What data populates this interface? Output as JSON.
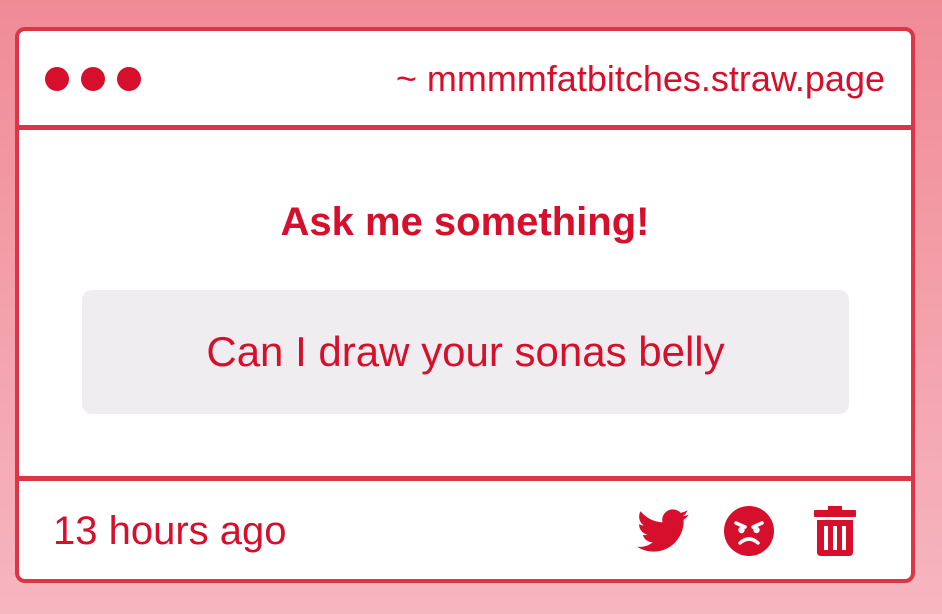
{
  "window": {
    "url": "~ mmmmfatbitches.straw.page"
  },
  "main": {
    "heading": "Ask me something!",
    "question": "Can I draw your sonas belly"
  },
  "footer": {
    "timestamp": "13 hours ago",
    "actions": [
      {
        "icon": "twitter-icon"
      },
      {
        "icon": "angry-face-icon"
      },
      {
        "icon": "trash-icon"
      }
    ]
  },
  "colors": {
    "accent": "#d50f2c",
    "border": "#dc3545",
    "question_bg": "#efedef",
    "background_top": "#f08b96",
    "background_bottom": "#f6b6c0"
  }
}
